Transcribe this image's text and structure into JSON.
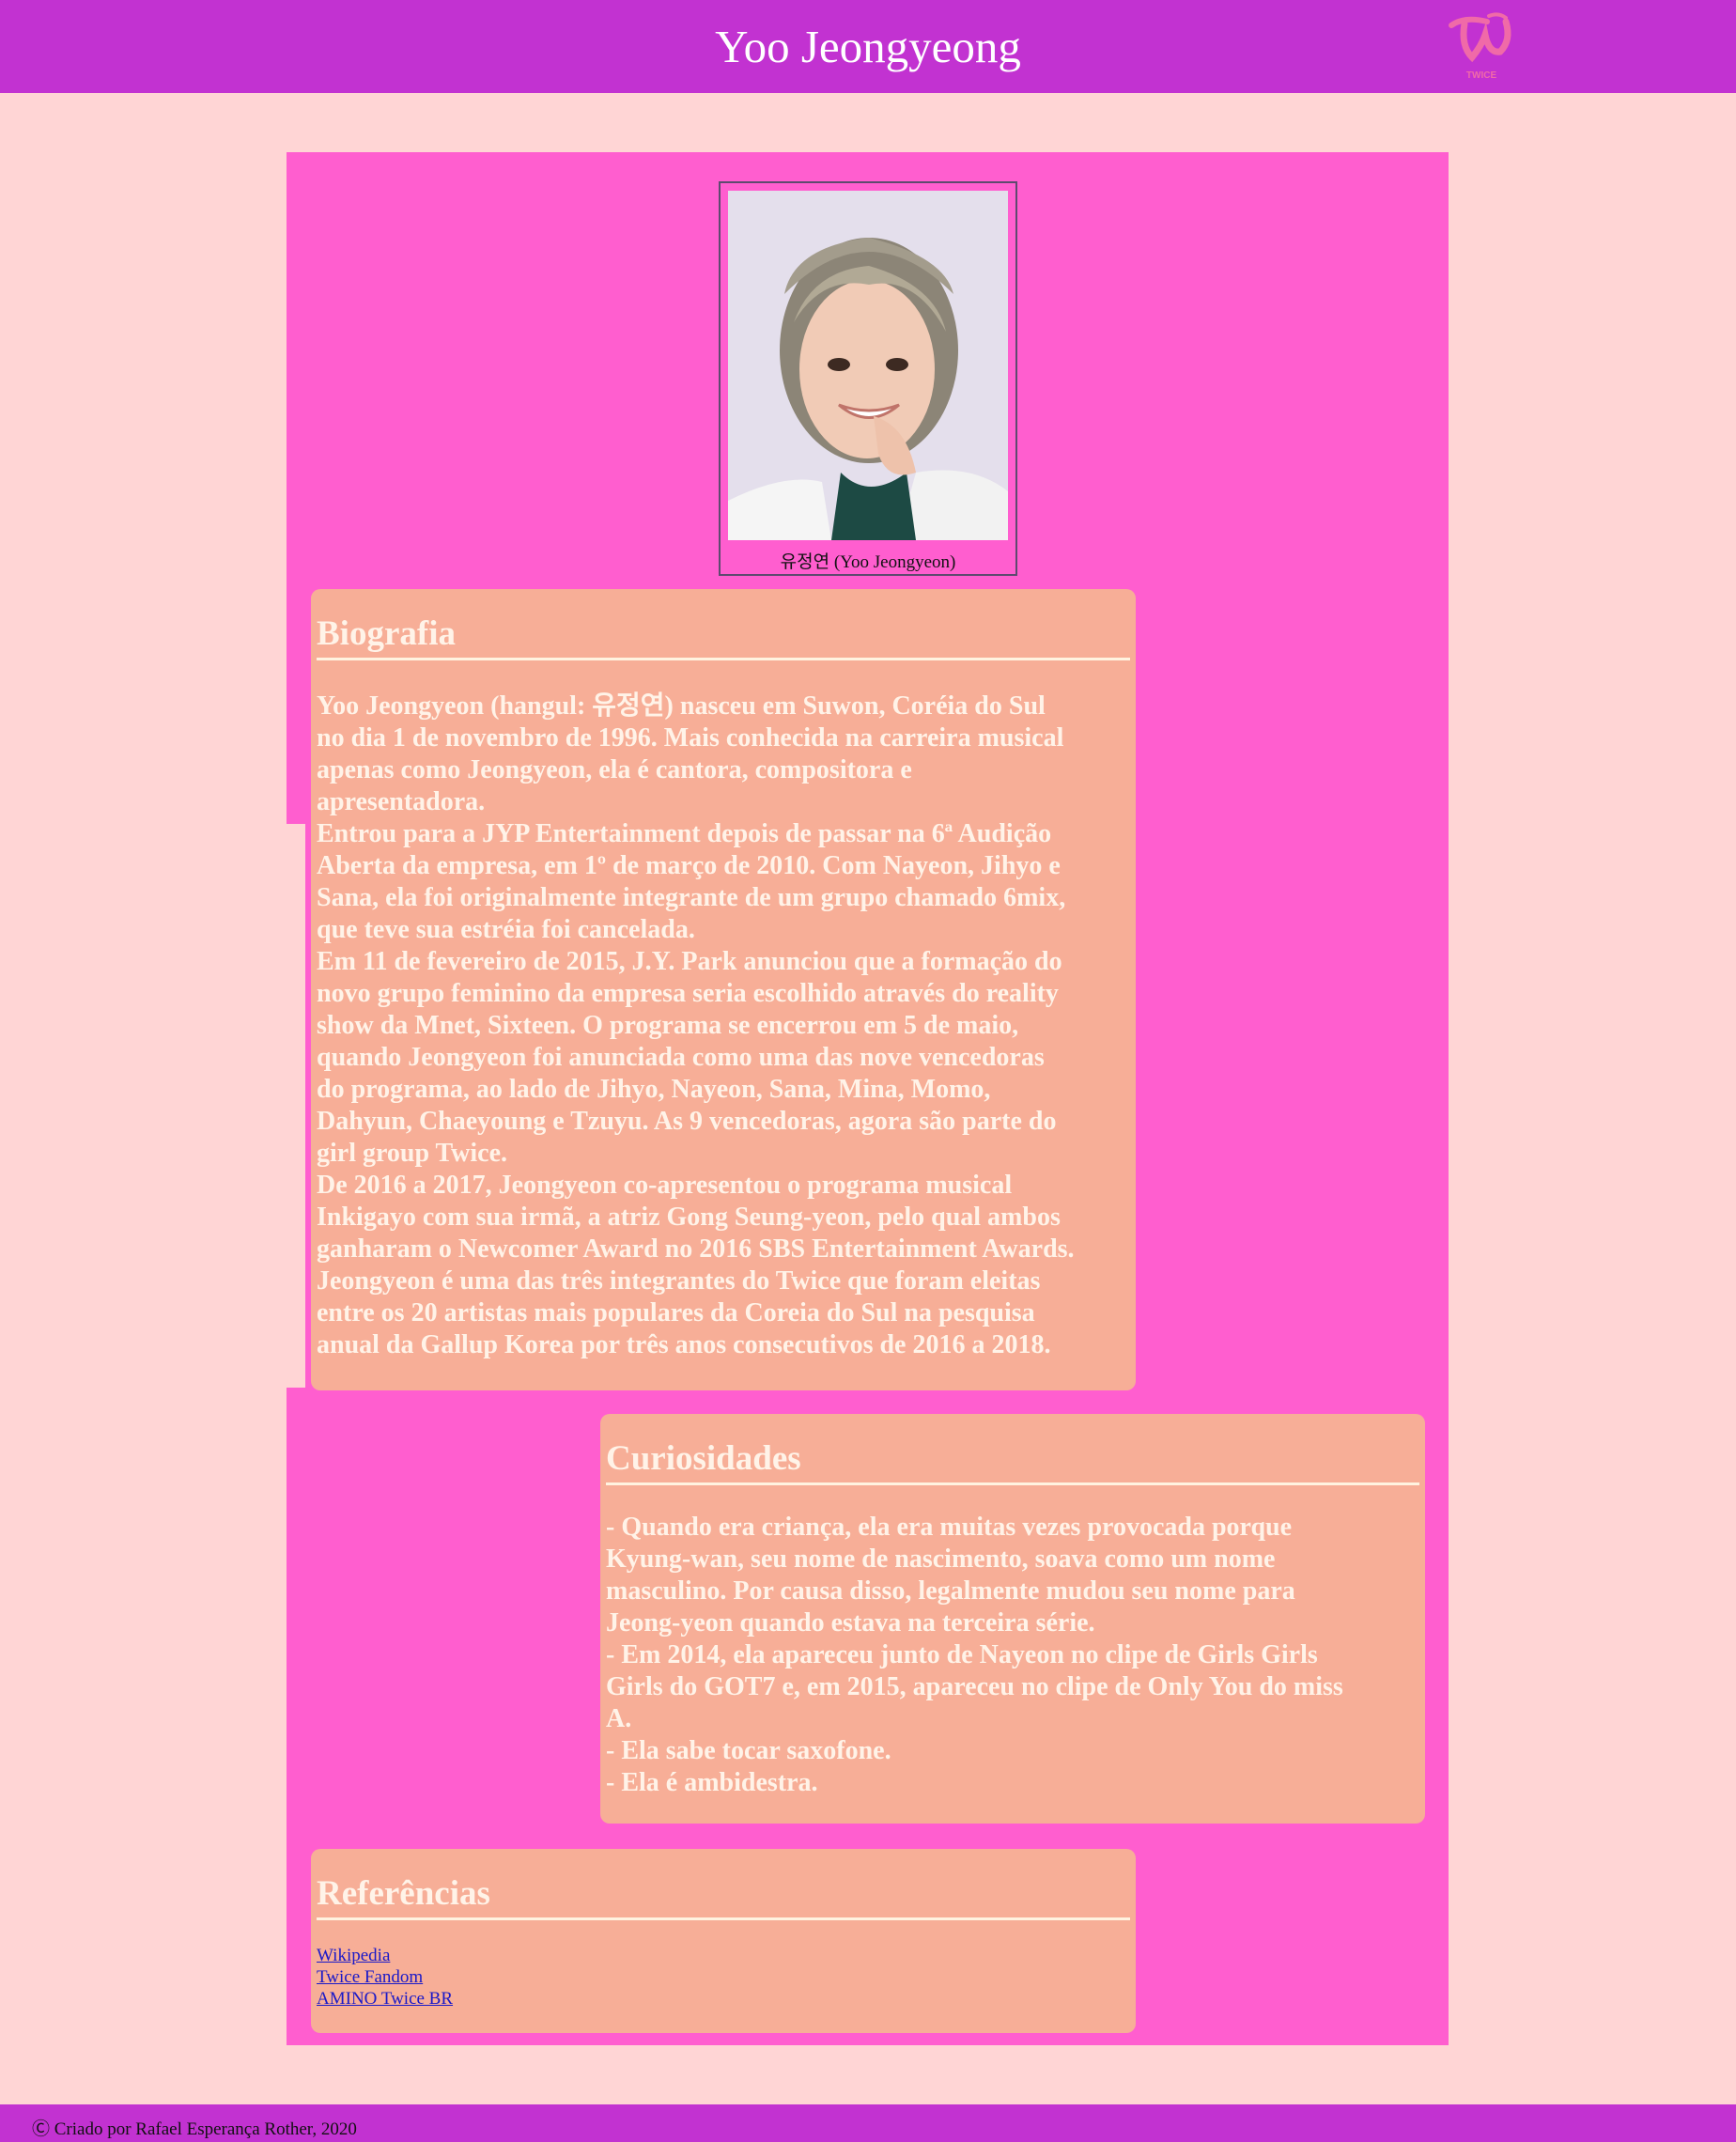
{
  "header": {
    "title": "Yoo Jeongyeong",
    "logo_text": "TWICE",
    "color": "#c232d1"
  },
  "profile": {
    "caption": "유정연 (Yoo Jeongyeon)",
    "photo_icon": "portrait-photo"
  },
  "biografia": {
    "heading": "Biografia",
    "text": "Yoo Jeongyeon (hangul: 유정연) nasceu em Suwon, Coréia do Sul\nno dia 1 de novembro de 1996. Mais conhecida na carreira musical\napenas como Jeongyeon, ela é cantora, compositora e\napresentadora.\nEntrou para a JYP Entertainment depois de passar na 6ª Audição\nAberta da empresa, em 1º de março de 2010. Com Nayeon, Jihyo e\nSana, ela foi originalmente integrante de um grupo chamado 6mix,\nque teve sua estréia foi cancelada.\nEm 11 de fevereiro de 2015, J.Y. Park anunciou que a formação do\nnovo grupo feminino da empresa seria escolhido através do reality\nshow da Mnet, Sixteen. O programa se encerrou em 5 de maio,\nquando Jeongyeon foi anunciada como uma das nove vencedoras\ndo programa, ao lado de Jihyo, Nayeon, Sana, Mina, Momo,\nDahyun, Chaeyoung e Tzuyu. As 9 vencedoras, agora são parte do\ngirl group Twice.\nDe 2016 a 2017, Jeongyeon co-apresentou o programa musical\nInkigayo com sua irmã, a atriz Gong Seung-yeon, pelo qual ambos\nganharam o Newcomer Award no 2016 SBS Entertainment Awards.\nJeongyeon é uma das três integrantes do Twice que foram eleitas\nentre os 20 artistas mais populares da Coreia do Sul na pesquisa\nanual da Gallup Korea por três anos consecutivos de 2016 a 2018."
  },
  "curiosidades": {
    "heading": "Curiosidades",
    "text": "- Quando era criança, ela era muitas vezes provocada porque\nKyung-wan, seu nome de nascimento, soava como um nome\nmasculino. Por causa disso, legalmente mudou seu nome para\nJeong-yeon quando estava na terceira série.\n- Em 2014, ela apareceu junto de Nayeon no clipe de Girls Girls\nGirls do GOT7 e, em 2015, apareceu no clipe de Only You do miss\nA.\n- Ela sabe tocar saxofone.\n- Ela é ambidestra."
  },
  "referencias": {
    "heading": "Referências",
    "links": [
      {
        "label": "Wikipedia"
      },
      {
        "label": "Twice Fandom"
      },
      {
        "label": "AMINO Twice BR"
      }
    ]
  },
  "footer": {
    "text": "Ⓒ Criado por Rafael Esperança Rother, 2020"
  }
}
